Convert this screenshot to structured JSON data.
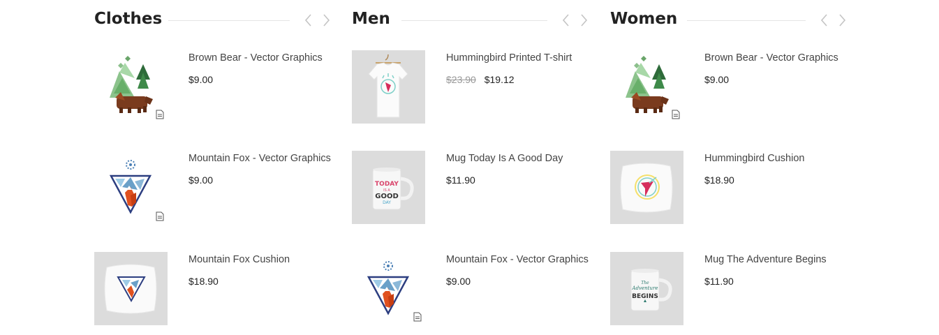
{
  "columns": [
    {
      "title": "Clothes",
      "prev_icon": "chevron-left-icon",
      "next_icon": "chevron-right-icon",
      "items": [
        {
          "name": "Brown Bear - Vector Graphics",
          "old_price": "",
          "price": "$9.00",
          "image": "brown-bear-illustration"
        },
        {
          "name": "Mountain Fox - Vector Graphics",
          "old_price": "",
          "price": "$9.00",
          "image": "mountain-fox-illustration"
        },
        {
          "name": "Mountain Fox Cushion",
          "old_price": "",
          "price": "$18.90",
          "image": "mountain-fox-cushion"
        }
      ]
    },
    {
      "title": "Men",
      "prev_icon": "chevron-left-icon",
      "next_icon": "chevron-right-icon",
      "items": [
        {
          "name": "Hummingbird Printed T-shirt",
          "old_price": "$23.90",
          "price": "$19.12",
          "image": "hummingbird-tshirt"
        },
        {
          "name": "Mug Today Is A Good Day",
          "old_price": "",
          "price": "$11.90",
          "image": "mug-today-good-day"
        },
        {
          "name": "Mountain Fox - Vector Graphics",
          "old_price": "",
          "price": "$9.00",
          "image": "mountain-fox-illustration"
        }
      ]
    },
    {
      "title": "Women",
      "prev_icon": "chevron-left-icon",
      "next_icon": "chevron-right-icon",
      "items": [
        {
          "name": "Brown Bear - Vector Graphics",
          "old_price": "",
          "price": "$9.00",
          "image": "brown-bear-illustration"
        },
        {
          "name": "Hummingbird Cushion",
          "old_price": "",
          "price": "$18.90",
          "image": "hummingbird-cushion"
        },
        {
          "name": "Mug The Adventure Begins",
          "old_price": "",
          "price": "$11.90",
          "image": "mug-adventure-begins"
        }
      ]
    }
  ],
  "mug_text": {
    "today_line1": "TODAY",
    "today_line2": "IS A",
    "today_line3": "GOOD",
    "today_line4": "DAY",
    "adventure_line1": "The",
    "adventure_line2": "Adventure",
    "adventure_line3": "BEGINS"
  },
  "colors": {
    "title": "#222222",
    "text": "#444444",
    "old_price": "#999999",
    "image_bg": "#dcdcdc",
    "divider": "#e5e5e5"
  }
}
